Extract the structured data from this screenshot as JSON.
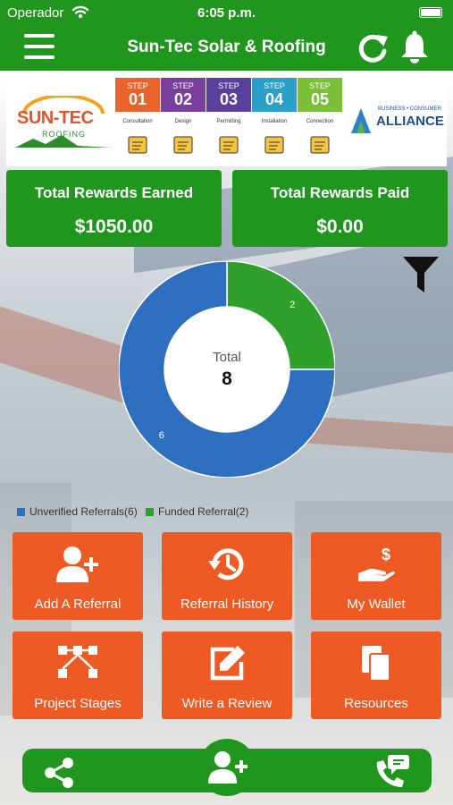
{
  "status_bar": {
    "carrier": "Operador",
    "time": "6:05 p.m."
  },
  "header": {
    "title": "Sun-Tec Solar & Roofing",
    "icons": [
      "menu-icon",
      "refresh-icon",
      "bell-icon"
    ]
  },
  "banner": {
    "company_name": "SUN-TEC",
    "company_sub": "ROOFING",
    "steps": [
      {
        "step": "STEP",
        "num": "01",
        "label": "Consultation",
        "color": "#e8642b"
      },
      {
        "step": "STEP",
        "num": "02",
        "label": "Design",
        "color": "#7a3f9c"
      },
      {
        "step": "STEP",
        "num": "03",
        "label": "Permitting",
        "color": "#5a3f9c"
      },
      {
        "step": "STEP",
        "num": "04",
        "label": "Installation",
        "color": "#2aa0c8"
      },
      {
        "step": "STEP",
        "num": "05",
        "label": "Connection",
        "color": "#7cc03a"
      }
    ],
    "partner_small": "BUSINESS • CONSUMER",
    "partner_big": "ALLIANCE"
  },
  "rewards": {
    "earned_label": "Total Rewards Earned",
    "earned_value": "$1050.00",
    "paid_label": "Total Rewards Paid",
    "paid_value": "$0.00"
  },
  "chart_data": {
    "type": "pie",
    "variant": "donut",
    "center_label": "Total",
    "center_value": "8",
    "series": [
      {
        "name": "Unverified Referrals(6)",
        "value": 6,
        "color": "#2e6fbf"
      },
      {
        "name": "Funded Referral(2)",
        "value": 2,
        "color": "#2fa02b"
      }
    ]
  },
  "tiles": [
    {
      "label": "Add A Referral",
      "icon": "add-user-icon"
    },
    {
      "label": "Referral History",
      "icon": "history-icon"
    },
    {
      "label": "My Wallet",
      "icon": "wallet-icon"
    },
    {
      "label": "Project Stages",
      "icon": "stages-icon"
    },
    {
      "label": "Write a Review",
      "icon": "edit-icon"
    },
    {
      "label": "Resources",
      "icon": "documents-icon"
    }
  ],
  "bottom_bar": {
    "icons": [
      "share-icon",
      "add-user-icon",
      "phone-chat-icon"
    ]
  },
  "colors": {
    "green": "#21961e",
    "orange": "#ee5a24",
    "blue": "#2e6fbf"
  }
}
